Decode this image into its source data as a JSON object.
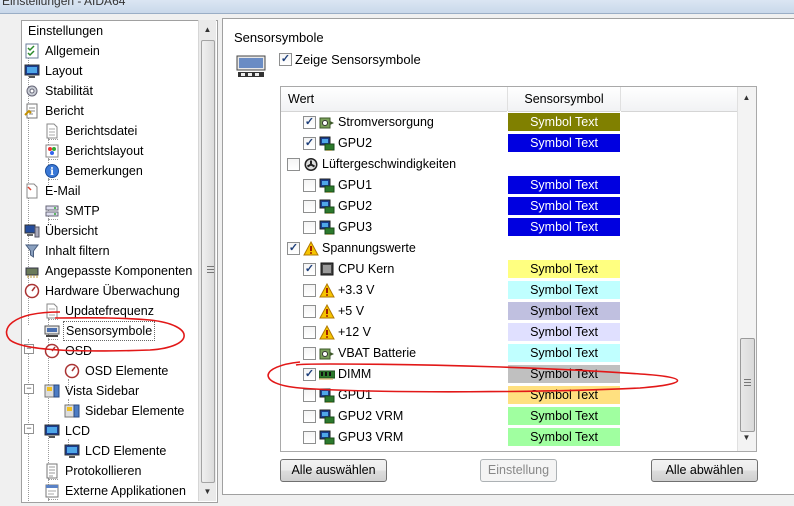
{
  "window": {
    "title": "Einstellungen - AIDA64"
  },
  "tree": {
    "items": [
      {
        "label": "Einstellungen",
        "icon": "none"
      },
      {
        "label": "Allgemein",
        "icon": "checklist-icon"
      },
      {
        "label": "Layout",
        "icon": "monitor-icon"
      },
      {
        "label": "Stabilität",
        "icon": "gear-icon"
      },
      {
        "label": "Bericht",
        "icon": "report-icon"
      },
      {
        "label": "Berichtsdatei",
        "icon": "document-icon"
      },
      {
        "label": "Berichtslayout",
        "icon": "palette-icon"
      },
      {
        "label": "Bemerkungen",
        "icon": "info-icon"
      },
      {
        "label": "E-Mail",
        "icon": "mail-icon"
      },
      {
        "label": "SMTP",
        "icon": "server-icon"
      },
      {
        "label": "Übersicht",
        "icon": "computer-icon"
      },
      {
        "label": "Inhalt filtern",
        "icon": "filter-icon"
      },
      {
        "label": "Angepasste Komponenten",
        "icon": "components-icon"
      },
      {
        "label": "Hardware Überwachung",
        "icon": "gauge-icon"
      },
      {
        "label": "Updatefrequenz",
        "icon": "document-icon"
      },
      {
        "label": "Sensorsymbole",
        "icon": "tray-icon"
      },
      {
        "label": "OSD",
        "icon": "gauge-icon"
      },
      {
        "label": "OSD Elemente",
        "icon": "gauge-icon"
      },
      {
        "label": "Vista Sidebar",
        "icon": "sidebar-icon"
      },
      {
        "label": "Sidebar Elemente",
        "icon": "sidebar-icon"
      },
      {
        "label": "LCD",
        "icon": "monitor-icon"
      },
      {
        "label": "LCD Elemente",
        "icon": "monitor-icon"
      },
      {
        "label": "Protokollieren",
        "icon": "log-icon"
      },
      {
        "label": "Externe Applikationen",
        "icon": "app-icon"
      }
    ]
  },
  "panel": {
    "section_title": "Sensorsymbole",
    "show_checkbox_label": "Zeige Sensorsymbole",
    "show_checked": true,
    "columns": {
      "value": "Wert",
      "symbol": "Sensorsymbol"
    },
    "rows": [
      {
        "label": "Stromversorgung",
        "checked": true,
        "icon": "power-icon",
        "symbol": "Symbol Text",
        "bg": "#808000",
        "fg": "#ffffff"
      },
      {
        "label": "GPU2",
        "checked": true,
        "icon": "gpu-icon",
        "symbol": "Symbol Text",
        "bg": "#0000e0",
        "fg": "#ffffff"
      },
      {
        "label": "Lüftergeschwindigkeiten",
        "checked": false,
        "icon": "fan-icon",
        "symbol": "",
        "bg": "",
        "fg": ""
      },
      {
        "label": "GPU1",
        "checked": false,
        "icon": "gpu-icon",
        "symbol": "Symbol Text",
        "bg": "#0000e0",
        "fg": "#ffffff"
      },
      {
        "label": "GPU2",
        "checked": false,
        "icon": "gpu-icon",
        "symbol": "Symbol Text",
        "bg": "#0000e0",
        "fg": "#ffffff"
      },
      {
        "label": "GPU3",
        "checked": false,
        "icon": "gpu-icon",
        "symbol": "Symbol Text",
        "bg": "#0000e0",
        "fg": "#ffffff"
      },
      {
        "label": "Spannungswerte",
        "checked": true,
        "icon": "warning-icon",
        "symbol": "",
        "bg": "",
        "fg": ""
      },
      {
        "label": "CPU Kern",
        "checked": true,
        "icon": "cpu-icon",
        "symbol": "Symbol Text",
        "bg": "#ffff80",
        "fg": "#000000"
      },
      {
        "label": "+3.3 V",
        "checked": false,
        "icon": "warning-icon",
        "symbol": "Symbol Text",
        "bg": "#c0ffff",
        "fg": "#000000"
      },
      {
        "label": "+5 V",
        "checked": false,
        "icon": "warning-icon",
        "symbol": "Symbol Text",
        "bg": "#c0c0e0",
        "fg": "#000000"
      },
      {
        "label": "+12 V",
        "checked": false,
        "icon": "warning-icon",
        "symbol": "Symbol Text",
        "bg": "#e0e0ff",
        "fg": "#000000"
      },
      {
        "label": "VBAT Batterie",
        "checked": false,
        "icon": "power-icon",
        "symbol": "Symbol Text",
        "bg": "#c0ffff",
        "fg": "#000000"
      },
      {
        "label": "DIMM",
        "checked": true,
        "icon": "memory-icon",
        "symbol": "Symbol Text",
        "bg": "#c0c0c0",
        "fg": "#000000"
      },
      {
        "label": "GPU1",
        "checked": false,
        "icon": "gpu-icon",
        "symbol": "Symbol Text",
        "bg": "#ffe080",
        "fg": "#000000"
      },
      {
        "label": "GPU2 VRM",
        "checked": false,
        "icon": "gpu-icon",
        "symbol": "Symbol Text",
        "bg": "#a0ffa0",
        "fg": "#000000"
      },
      {
        "label": "GPU3 VRM",
        "checked": false,
        "icon": "gpu-icon",
        "symbol": "Symbol Text",
        "bg": "#a0ffa0",
        "fg": "#000000"
      }
    ]
  },
  "buttons": {
    "select_all": "Alle auswählen",
    "settings": "Einstellung",
    "deselect_all": "Alle abwählen"
  }
}
